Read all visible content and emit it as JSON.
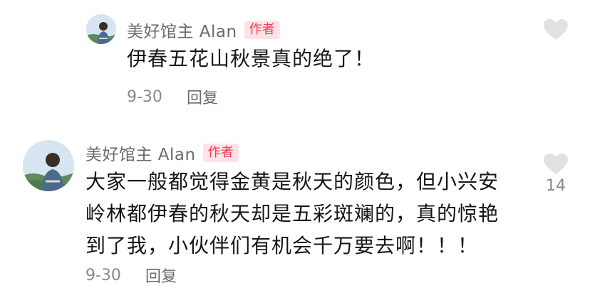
{
  "comments": [
    {
      "username": "美好馆主 Alan",
      "badge": "作者",
      "text": "伊春五花山秋景真的绝了！",
      "date": "9-30",
      "reply_label": "回复",
      "like_icon": "heart-outline-icon",
      "like_count": ""
    },
    {
      "username": "美好馆主 Alan",
      "badge": "作者",
      "text_lines": [
        "大家一般都觉得金黄是秋天的颜色，但小兴安",
        "岭林都伊春的秋天却是五彩斑斓的，真的惊艳",
        "到了我，小伙伴们有机会千万要去啊！！！"
      ],
      "date": "9-30",
      "reply_label": "回复",
      "like_icon": "heart-outline-icon",
      "like_count": "14"
    }
  ],
  "colors": {
    "badge_text": "#f23c55",
    "badge_bg": "#fde3e6",
    "username": "#6b6b6b",
    "body_text": "#161616",
    "meta_text": "#8a8a8a",
    "heart": "#e1e1e1"
  }
}
